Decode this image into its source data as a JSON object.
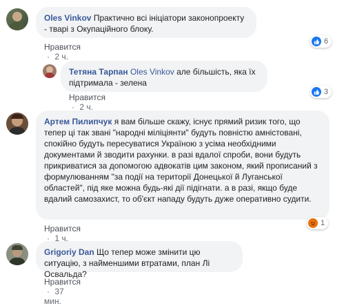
{
  "comments": [
    {
      "author": "Oles Vinkov",
      "text": "Практично всі ініціатори законопроекту - тварі з Окупаційного блоку.",
      "like_label": "Нравится",
      "time": "2 ч.",
      "reaction_count": "6",
      "reaction_type": "like-icon"
    },
    {
      "author": "Тетяна Тарпан",
      "mention": "Oles Vinkov",
      "text": "але більшість, яка їх підтримала - зелена",
      "like_label": "Нравится",
      "time": "2 ч.",
      "reaction_count": "3",
      "reaction_type": "like-icon"
    },
    {
      "author": "Артем Пилипчук",
      "text": "я вам більше скажу, існує прямий ризик того, що тепер ці так звані \"народні міліціянти\" будуть повністю амністовані, спокійно будуть пересуватися Україною з усіма необхідними документами й зводити рахунки. в разі вдалої спроби, вони будуть прикриватися за допомогою адвокатів цим законом, який прописаний з формулюванням \"за події на території Донецької й Луганської областей\", під яке можна будь-які дії підігнати. а в разі, якщо буде вдалий самозахист, то об'єкт нападу будуть дуже оперативно судити.",
      "like_label": "Нравится",
      "time": "1 ч.",
      "reaction_count": "1",
      "reaction_type": "angry-icon"
    },
    {
      "author": "Grigoriy Dan",
      "text": "Що тепер може змінити цю ситуацію, з найменшими втратами, план Лі Освальда?",
      "like_label": "Нравится",
      "time": "37 мин."
    }
  ],
  "separator": "·",
  "colors": {
    "author": "#385898",
    "bubble": "#f2f3f5",
    "like": "#1877f2",
    "angry": "#e9710f"
  }
}
